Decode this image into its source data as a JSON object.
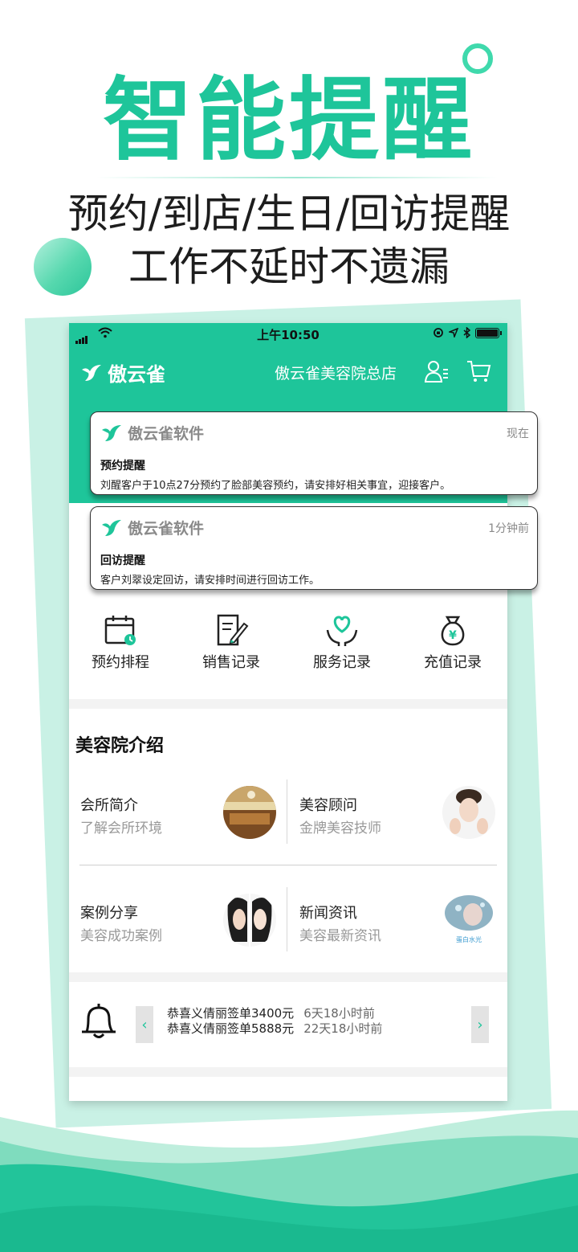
{
  "promo": {
    "headline": "智能提醒",
    "sub1": "预约/到店/生日/回访提醒",
    "sub2": "工作不延时不遗漏"
  },
  "status_bar": {
    "time": "上午10:50"
  },
  "navbar": {
    "brand": "傲云雀",
    "store_name": "傲云雀美容院总店"
  },
  "notifications": [
    {
      "app": "傲云雀软件",
      "time": "现在",
      "title": "预约提醒",
      "body": "刘醒客户于10点27分预约了脸部美容预约，请安排好相关事宜，迎接客户。"
    },
    {
      "app": "傲云雀软件",
      "time": "1分钟前",
      "title": "回访提醒",
      "body": "客户刘翠设定回访，请安排时间进行回访工作。"
    }
  ],
  "quick_actions": [
    {
      "label": "预约排程",
      "icon": "calendar-icon"
    },
    {
      "label": "销售记录",
      "icon": "edit-document-icon"
    },
    {
      "label": "服务记录",
      "icon": "heart-hands-icon"
    },
    {
      "label": "充值记录",
      "icon": "money-bag-icon"
    }
  ],
  "intro": {
    "title": "美容院介绍",
    "cards": [
      {
        "title": "会所简介",
        "subtitle": "了解会所环境"
      },
      {
        "title": "美容顾问",
        "subtitle": "金牌美容技师"
      },
      {
        "title": "案例分享",
        "subtitle": "美容成功案例"
      },
      {
        "title": "新闻资讯",
        "subtitle": "美容最新资讯",
        "thumb_caption": "蛋白水光"
      }
    ]
  },
  "news_ticker": [
    {
      "text": "恭喜义倩丽签单3400元",
      "ago": "6天18小时前"
    },
    {
      "text": "恭喜义倩丽签单5888元",
      "ago": "22天18小时前"
    }
  ],
  "colors": {
    "brand_green": "#1ec59a",
    "light_green": "#c9f1e5"
  }
}
